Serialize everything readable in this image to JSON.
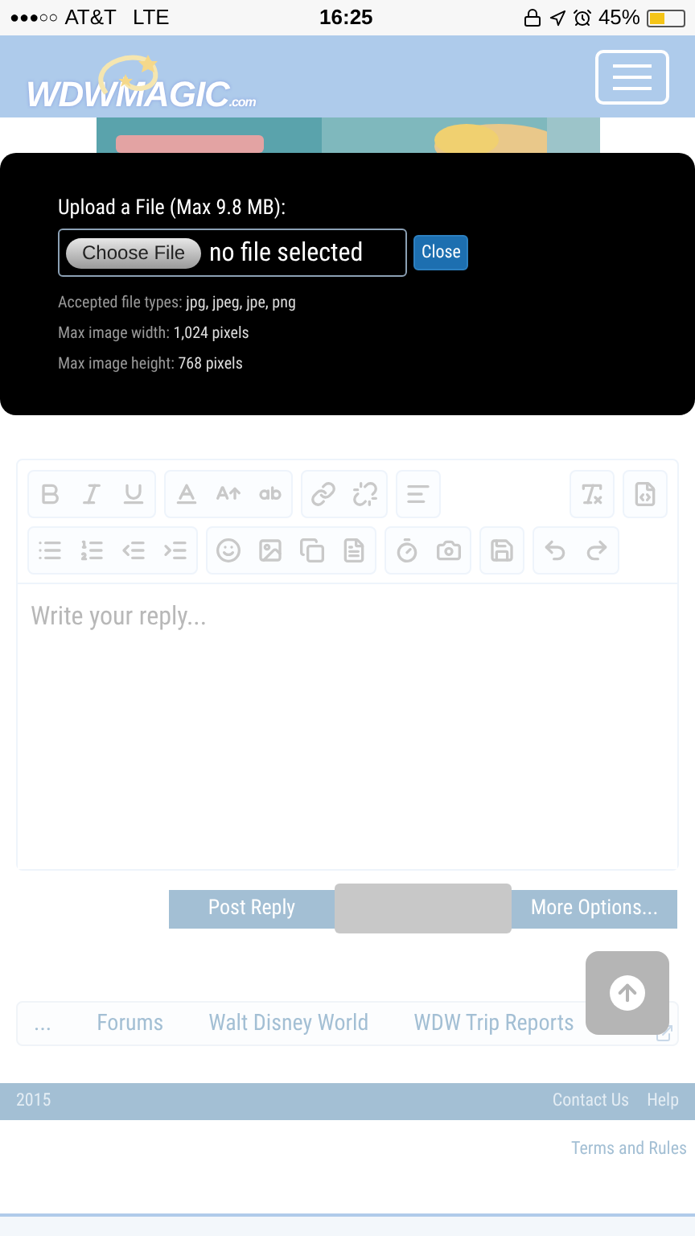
{
  "status_bar": {
    "signal": "●●●○○",
    "carrier": "AT&T",
    "network": "LTE",
    "time": "16:25",
    "battery": "45%"
  },
  "header": {
    "logo": "WDWMAGIC",
    "logo_suffix": ".com"
  },
  "upload_dialog": {
    "title": "Upload a File (Max 9.8 MB):",
    "choose_button": "Choose File",
    "file_status": "no file selected",
    "close_button": "Close",
    "notes": [
      {
        "label": "Accepted file types:",
        "value": "jpg, jpeg, jpe, png"
      },
      {
        "label": "Max image width:",
        "value": "1,024 pixels"
      },
      {
        "label": "Max image height:",
        "value": "768 pixels"
      }
    ]
  },
  "editor": {
    "placeholder": "Write your reply..."
  },
  "actions": {
    "post_button": "Post Reply",
    "more_button": "More Options..."
  },
  "breadcrumb": [
    "...",
    "Forums",
    "Walt Disney World",
    "WDW Trip Reports"
  ],
  "footer": {
    "year": "2015",
    "links": [
      "Contact Us",
      "Help"
    ],
    "terms": "Terms and Rules"
  }
}
